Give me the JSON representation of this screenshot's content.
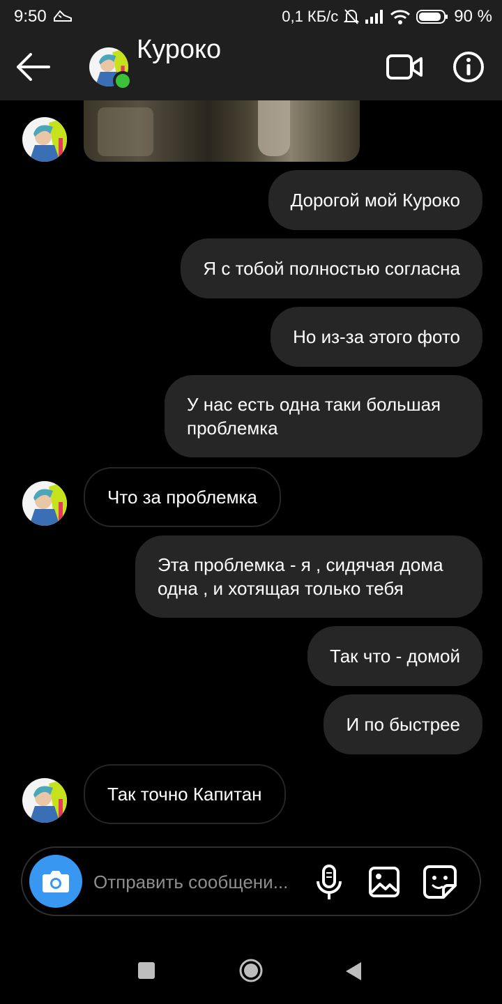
{
  "status_bar": {
    "time": "9:50",
    "network_speed": "0,1 КБ/с",
    "battery": "90 %",
    "icons": [
      "activity-shoe-icon",
      "mute-bell-icon",
      "signal-icon",
      "wifi-icon",
      "battery-icon"
    ]
  },
  "header": {
    "contact_name": "Куроко",
    "online": true,
    "icons": [
      "back-arrow-icon",
      "video-call-icon",
      "info-icon"
    ]
  },
  "messages": [
    {
      "direction": "in",
      "type": "photo",
      "text": ""
    },
    {
      "direction": "out",
      "text": "Дорогой мой Куроко"
    },
    {
      "direction": "out",
      "text": "Я с тобой полностью согласна"
    },
    {
      "direction": "out",
      "text": "Но из-за этого фото"
    },
    {
      "direction": "out",
      "text": "У нас есть одна таки большая проблемка"
    },
    {
      "direction": "in",
      "text": "Что за проблемка"
    },
    {
      "direction": "out",
      "text": "Эта проблемка - я , сидячая дома одна , и хотящая только тебя"
    },
    {
      "direction": "out",
      "text": "Так что - домой"
    },
    {
      "direction": "out",
      "text": "И по быстрее"
    },
    {
      "direction": "in",
      "text": "Так точно Капитан"
    }
  ],
  "composer": {
    "placeholder": "Отправить сообщени...",
    "icons": [
      "camera-icon",
      "microphone-icon",
      "gallery-icon",
      "sticker-icon"
    ]
  },
  "colors": {
    "background": "#000000",
    "bar": "#1f1f1f",
    "outgoing_bubble": "#262626",
    "incoming_border": "#262626",
    "online": "#3cc13b",
    "camera_button": "#3897f0"
  }
}
